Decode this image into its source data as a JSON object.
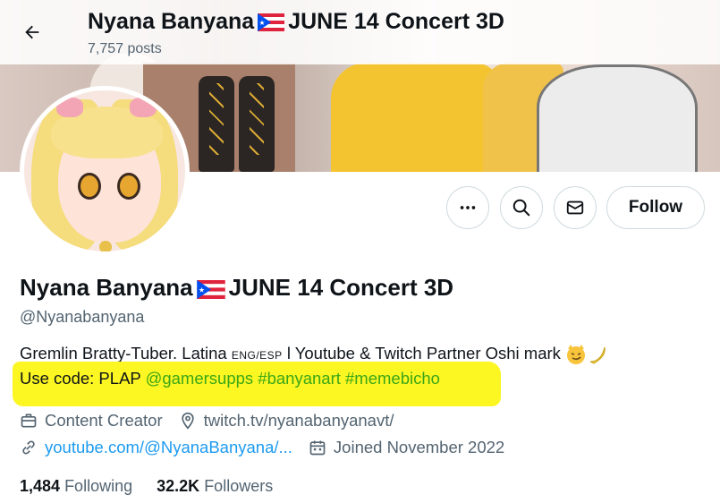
{
  "header": {
    "title_prefix": "Nyana Banyana",
    "title_suffix": "JUNE 14 Concert 3D",
    "posts": "7,757 posts"
  },
  "profile": {
    "name_prefix": "Nyana Banyana",
    "name_suffix": "JUNE 14 Concert 3D",
    "handle": "@Nyanabanyana",
    "bio_line1_a": "Gremlin Bratty-Tuber. Latina ",
    "bio_line1_small": "ENG/ESP",
    "bio_line1_b": " l Youtube & Twitch Partner Oshi mark ",
    "bio_line2_text": "Use code: PLAP ",
    "bio_line2_mention": "@gamersupps",
    "bio_line2_tag1": "#banyanart",
    "bio_line2_tag2": "#memebicho",
    "category": "Content Creator",
    "website1": "twitch.tv/nyanabanyanavt/",
    "website2": "youtube.com/@NyanaBanyana/...",
    "joined": "Joined November 2022"
  },
  "stats": {
    "following_count": "1,484",
    "following_label": "Following",
    "followers_count": "32.2K",
    "followers_label": "Followers"
  },
  "actions": {
    "follow_label": "Follow"
  },
  "icons": {
    "back": "arrow-left-icon",
    "more": "more-horizontal-icon",
    "search": "search-icon",
    "message": "mail-icon",
    "category": "briefcase-icon",
    "location_link": "location-pin-icon",
    "link": "link-icon",
    "calendar": "calendar-icon",
    "flag": "puerto-rico-flag-icon"
  },
  "colors": {
    "highlight": "#fcf622",
    "link_blue": "#1d9bf0",
    "hashtag_green": "#3ba716",
    "muted": "#536471"
  }
}
